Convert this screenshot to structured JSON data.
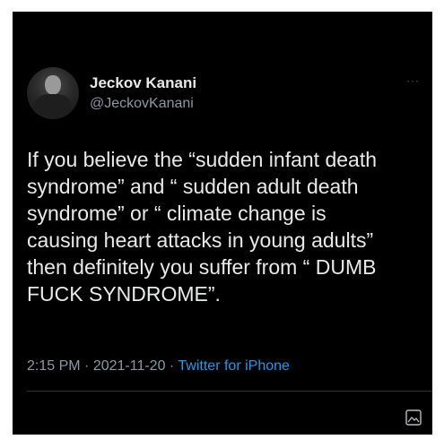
{
  "author": {
    "display_name": "Jeckov Kanani",
    "handle": "@JeckovKanani"
  },
  "menu": {
    "more_label": "···"
  },
  "tweet": {
    "lines": [
      "If you believe the “sudden infant death",
      "syndrome” and “ sudden adult death",
      "syndrome” or “ climate change is",
      "causing heart attacks in young adults”",
      "then definitely you suffer from “ DUMB",
      "FUCK SYNDROME”."
    ]
  },
  "meta": {
    "time": "2:15 PM",
    "sep1": " · ",
    "date": "2021-11-20",
    "sep2": " · ",
    "source": "Twitter for iPhone"
  },
  "icons": {
    "avatar": "profile-photo",
    "corner": "image-icon"
  },
  "colors": {
    "background": "#000000",
    "text": "#e7e9ea",
    "secondary": "#8b98a5",
    "link": "#1d9bf0"
  }
}
